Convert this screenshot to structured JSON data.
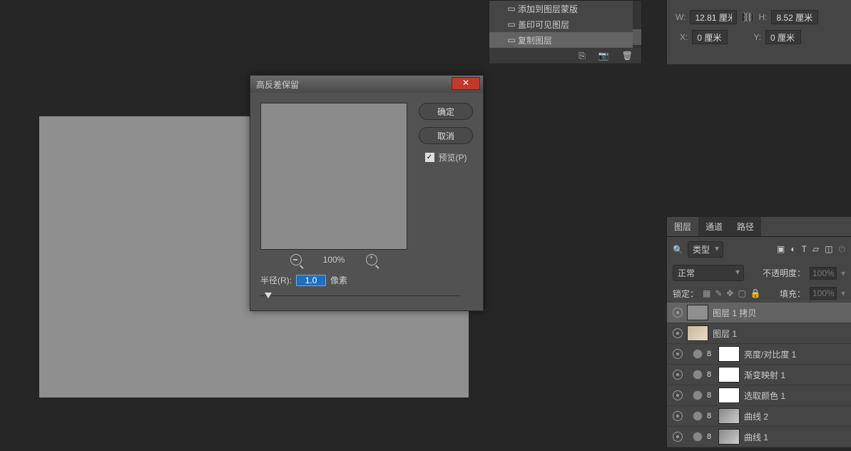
{
  "context_menu": {
    "items": [
      {
        "label": "添加到图层蒙版"
      },
      {
        "label": "盖印可见图层"
      },
      {
        "label": "复制图层"
      }
    ]
  },
  "props": {
    "w_label": "W:",
    "w_value": "12.81 厘米",
    "h_label": "H:",
    "h_value": "8.52 厘米",
    "x_label": "X:",
    "x_value": "0 厘米",
    "y_label": "Y:",
    "y_value": "0 厘米"
  },
  "dialog": {
    "title": "高反差保留",
    "ok": "确定",
    "cancel": "取消",
    "preview": "预览(P)",
    "zoom": "100%",
    "radius_label": "半径(R):",
    "radius_value": "1.0",
    "radius_unit": "像素"
  },
  "layers_panel": {
    "tabs": {
      "layers": "图层",
      "channels": "通道",
      "paths": "路径"
    },
    "type_filter_placeholder": "类型",
    "blend_mode": "正常",
    "opacity_label": "不透明度：",
    "opacity_value": "100%",
    "lock_label": "锁定：",
    "fill_label": "填充：",
    "fill_value": "100%",
    "layers": [
      {
        "name": "图层 1 拷贝"
      },
      {
        "name": "图层 1"
      },
      {
        "name": "亮度/对比度 1"
      },
      {
        "name": "渐变映射 1"
      },
      {
        "name": "选取颜色 1"
      },
      {
        "name": "曲线 2"
      },
      {
        "name": "曲线 1"
      }
    ]
  }
}
